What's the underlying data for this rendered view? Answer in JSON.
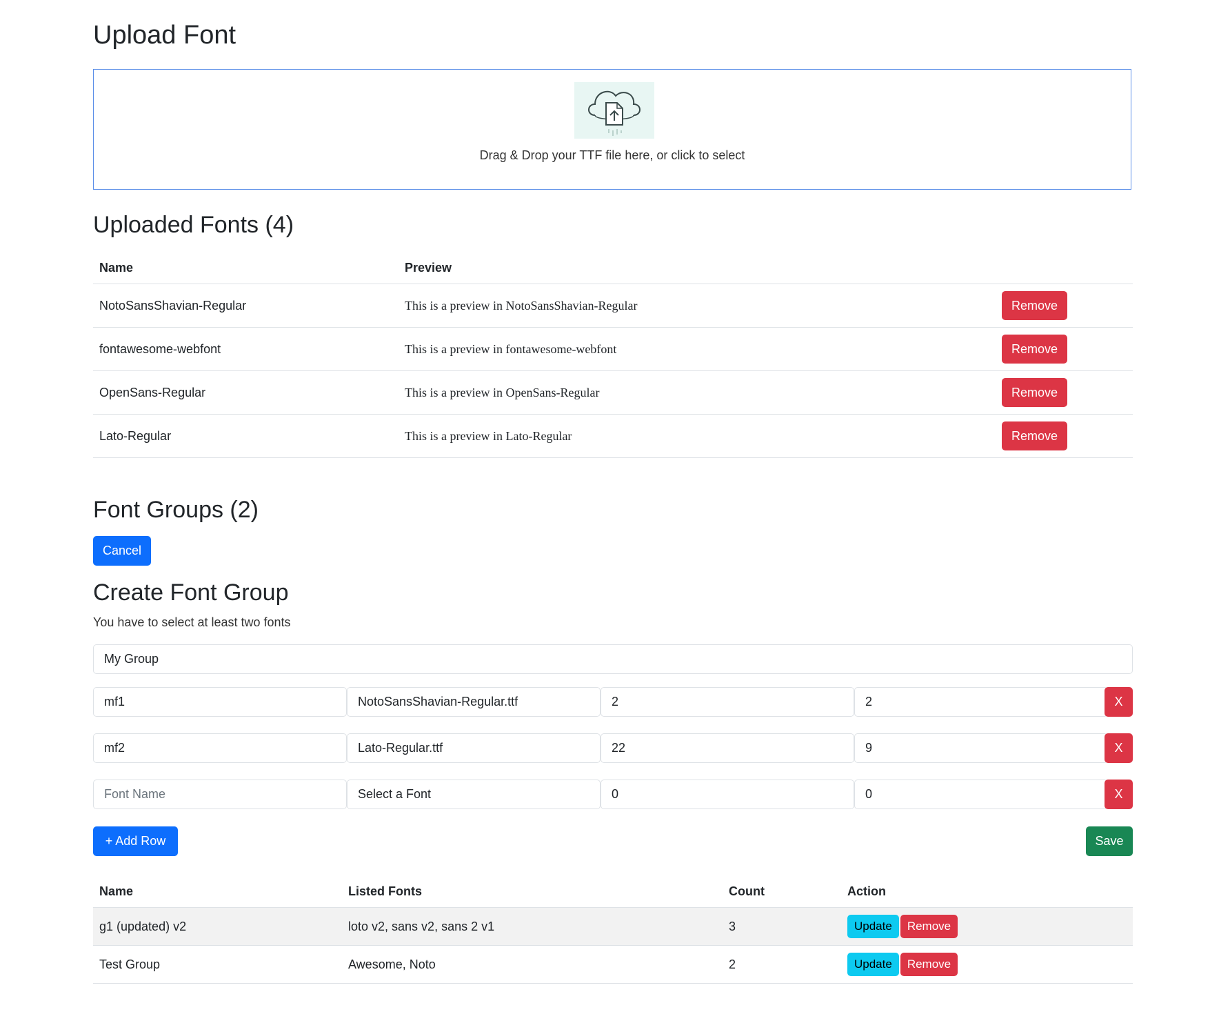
{
  "upload": {
    "title": "Upload Font",
    "drop_text": "Drag & Drop your TTF file here, or click to select"
  },
  "uploaded": {
    "title": "Uploaded Fonts (4)",
    "columns": [
      "Name",
      "Preview"
    ],
    "rows": [
      {
        "name": "NotoSansShavian-Regular",
        "preview": "This is a preview in NotoSansShavian-Regular",
        "action": "Remove"
      },
      {
        "name": "fontawesome-webfont",
        "preview": "This is a preview in fontawesome-webfont",
        "action": "Remove"
      },
      {
        "name": "OpenSans-Regular",
        "preview": "This is a preview in OpenSans-Regular",
        "action": "Remove"
      },
      {
        "name": "Lato-Regular",
        "preview": "This is a preview in Lato-Regular",
        "action": "Remove"
      }
    ]
  },
  "groups": {
    "title": "Font Groups (2)",
    "cancel_label": "Cancel"
  },
  "create": {
    "title": "Create Font Group",
    "helper": "You have to select at least two fonts",
    "group_name_value": "My Group",
    "rows": [
      {
        "font_name": "mf1",
        "font_name_placeholder": "Font Name",
        "font_file": "NotoSansShavian-Regular.ttf",
        "size": "2",
        "price": "2",
        "remove": "X"
      },
      {
        "font_name": "mf2",
        "font_name_placeholder": "Font Name",
        "font_file": "Lato-Regular.ttf",
        "size": "22",
        "price": "9",
        "remove": "X"
      },
      {
        "font_name": "",
        "font_name_placeholder": "Font Name",
        "font_file": "Select a Font",
        "size": "0",
        "price": "0",
        "remove": "X"
      }
    ],
    "add_row_label": "+ Add Row",
    "save_label": "Save"
  },
  "group_list": {
    "columns": [
      "Name",
      "Listed Fonts",
      "Count",
      "Action"
    ],
    "rows": [
      {
        "name": "g1 (updated) v2",
        "fonts": "loto v2, sans v2, sans 2 v1",
        "count": "3",
        "update": "Update",
        "remove": "Remove"
      },
      {
        "name": "Test Group",
        "fonts": "Awesome, Noto",
        "count": "2",
        "update": "Update",
        "remove": "Remove"
      }
    ]
  },
  "colors": {
    "primary": "#0d6efd",
    "danger": "#dc3545",
    "success": "#198754",
    "info": "#0dcaf0",
    "dropzone_border": "#5a8ee8"
  },
  "icons": [
    "cloud-upload-icon"
  ]
}
